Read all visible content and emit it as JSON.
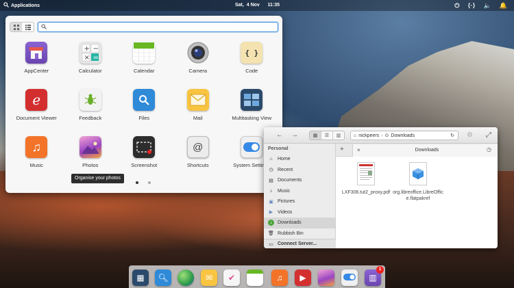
{
  "panel": {
    "applications_label": "Applications",
    "clock": "Sat,  4 Nov      11:35",
    "tray_icons": [
      "power-icon",
      "network-icon",
      "volume-icon",
      "notifications-icon"
    ]
  },
  "launcher": {
    "search": {
      "value": "",
      "placeholder": ""
    },
    "apps": [
      {
        "label": "AppCenter",
        "icon": "appcenter-icon",
        "color": "#7e57c2"
      },
      {
        "label": "Calculator",
        "icon": "calculator-icon",
        "color": "#5c6b73"
      },
      {
        "label": "Calendar",
        "icon": "calendar-icon",
        "color": "#68b723"
      },
      {
        "label": "Camera",
        "icon": "camera-icon",
        "color": "#7a7a7a"
      },
      {
        "label": "Code",
        "icon": "code-icon",
        "color": "#f4e3b1"
      },
      {
        "label": "Document Viewer",
        "icon": "document-viewer-icon",
        "color": "#d32f2f"
      },
      {
        "label": "Feedback",
        "icon": "feedback-icon",
        "color": "#7cbf3a"
      },
      {
        "label": "Files",
        "icon": "files-icon",
        "color": "#2f8ad8"
      },
      {
        "label": "Mail",
        "icon": "mail-icon",
        "color": "#f9c440"
      },
      {
        "label": "Multitasking View",
        "icon": "multitasking-icon",
        "color": "#2b4a6b"
      },
      {
        "label": "Music",
        "icon": "music-icon",
        "color": "#f37329"
      },
      {
        "label": "Photos",
        "icon": "photos-icon",
        "color": "#b04bb6"
      },
      {
        "label": "Screenshot",
        "icon": "screenshot-icon",
        "color": "#2d2d2d"
      },
      {
        "label": "Shortcuts",
        "icon": "shortcuts-icon",
        "color": "#e8e8e8"
      },
      {
        "label": "System Settings",
        "icon": "system-settings-icon",
        "color": "#3689e6"
      }
    ],
    "tooltip": "Organise your photos",
    "page_count": 2,
    "current_page": 1
  },
  "files_window": {
    "path": [
      "nickpeers",
      "Downloads"
    ],
    "tab_label": "Downloads",
    "sidebar_header": "Personal",
    "sidebar_items": [
      {
        "label": "Home",
        "icon": "home-icon"
      },
      {
        "label": "Recent",
        "icon": "recent-icon"
      },
      {
        "label": "Documents",
        "icon": "documents-icon"
      },
      {
        "label": "Music",
        "icon": "music-folder-icon"
      },
      {
        "label": "Pictures",
        "icon": "pictures-icon"
      },
      {
        "label": "Videos",
        "icon": "videos-icon"
      },
      {
        "label": "Downloads",
        "icon": "downloads-icon",
        "active": true
      },
      {
        "label": "Rubbish Bin",
        "icon": "trash-icon"
      }
    ],
    "connect_server": "Connect Server...",
    "files": [
      {
        "name": "LXF306.tut2_proxy.pdf",
        "icon": "pdf-file-icon"
      },
      {
        "name": "org.libreoffice.LibreOffice.flatpakref",
        "icon": "package-file-icon"
      }
    ]
  },
  "dock": {
    "items": [
      {
        "name": "multitasking",
        "icon": "multitasking-icon",
        "color": "#2b4a6b"
      },
      {
        "name": "files",
        "icon": "files-icon",
        "color": "#2f8ad8"
      },
      {
        "name": "web-browser",
        "icon": "web-browser-icon",
        "color": "#2e9c4a"
      },
      {
        "name": "mail",
        "icon": "mail-icon",
        "color": "#f9c440"
      },
      {
        "name": "tasks",
        "icon": "tasks-icon",
        "color": "#f5f5f5"
      },
      {
        "name": "calendar",
        "icon": "calendar-icon",
        "color": "#68b723"
      },
      {
        "name": "music",
        "icon": "music-icon",
        "color": "#f37329"
      },
      {
        "name": "videos",
        "icon": "videos-icon",
        "color": "#d32f2f"
      },
      {
        "name": "photos",
        "icon": "photos-icon",
        "color": "#b04bb6"
      },
      {
        "name": "system-settings",
        "icon": "system-settings-icon",
        "color": "#3689e6"
      },
      {
        "name": "appcenter",
        "icon": "appcenter-icon",
        "color": "#7e57c2",
        "badge": "1"
      }
    ]
  }
}
